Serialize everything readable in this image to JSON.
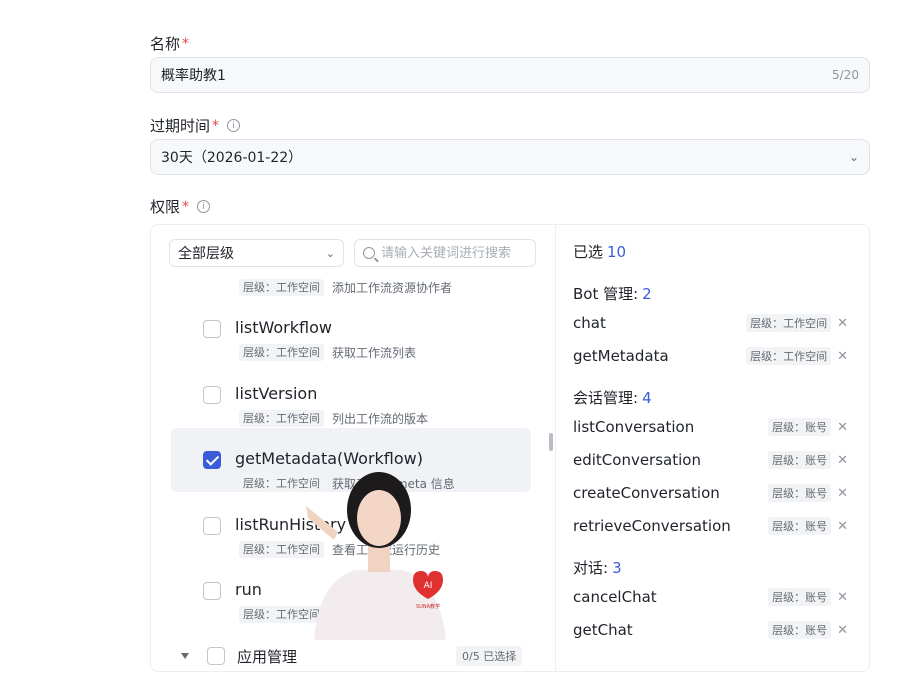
{
  "form": {
    "name_label": "名称",
    "name_value": "概率助教1",
    "name_counter": "5/20",
    "expiry_label": "过期时间",
    "expiry_value": "30天（2026-01-22）",
    "perm_label": "权限",
    "required_mark": "*",
    "info_glyph": "i"
  },
  "permissions": {
    "level_filter": "全部层级",
    "search_placeholder": "请输入关键词进行搜索",
    "partial_item": {
      "level": "层级：工作空间",
      "desc": "添加工作流资源协作者"
    },
    "items": [
      {
        "name": "listWorkflow",
        "level": "层级：工作空间",
        "desc": "获取工作流列表",
        "checked": false
      },
      {
        "name": "listVersion",
        "level": "层级：工作空间",
        "desc": "列出工作流的版本",
        "checked": false
      },
      {
        "name": "getMetadata(Workflow)",
        "level": "层级：工作空间",
        "desc": "获取工作流 meta 信息",
        "checked": true
      },
      {
        "name": "listRunHistory",
        "level": "层级：工作空间",
        "desc": "查看工作流运行历史",
        "checked": false
      },
      {
        "name": "run",
        "level": "层级：工作空间",
        "desc": "运行工作流",
        "checked": false
      }
    ],
    "group": {
      "name": "应用管理",
      "count": "0/5 已选择"
    }
  },
  "selected": {
    "title": "已选",
    "total": "10",
    "groups": [
      {
        "name": "Bot 管理:",
        "count": "2",
        "items": [
          {
            "name": "chat",
            "level": "层级：工作空间"
          },
          {
            "name": "getMetadata",
            "level": "层级：工作空间"
          }
        ]
      },
      {
        "name": "会话管理:",
        "count": "4",
        "items": [
          {
            "name": "listConversation",
            "level": "层级：账号"
          },
          {
            "name": "editConversation",
            "level": "层级：账号"
          },
          {
            "name": "createConversation",
            "level": "层级：账号"
          },
          {
            "name": "retrieveConversation",
            "level": "层级：账号"
          }
        ]
      },
      {
        "name": "对话:",
        "count": "3",
        "items": [
          {
            "name": "cancelChat",
            "level": "层级：账号"
          },
          {
            "name": "getChat",
            "level": "层级：账号"
          }
        ]
      }
    ],
    "remove_glyph": "✕"
  },
  "overlay": {
    "badge_text": "AI",
    "caption": "SUNA教学"
  },
  "colors": {
    "accent": "#3b5bdb",
    "required": "#e5484d",
    "badge": "#e03131"
  }
}
